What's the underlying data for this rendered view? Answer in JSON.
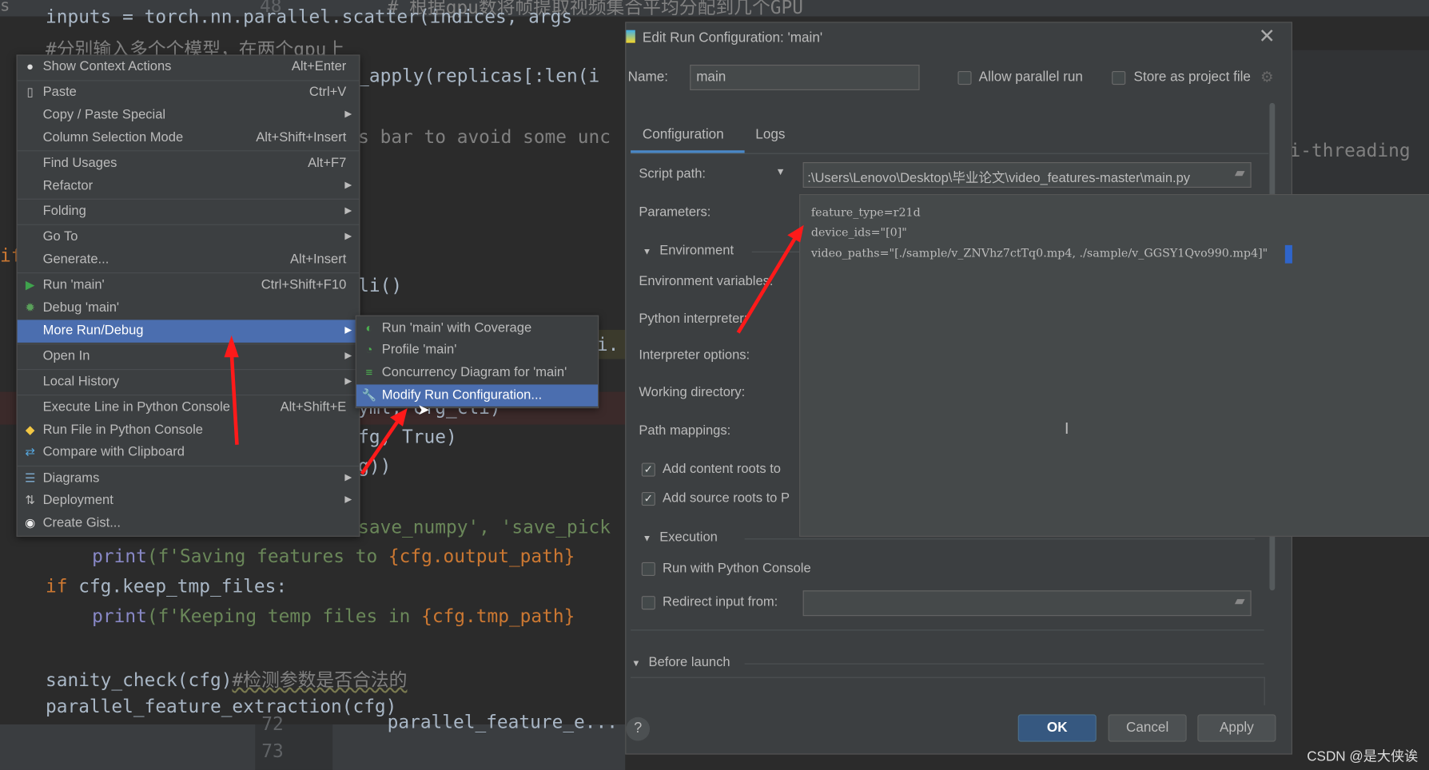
{
  "editor": {
    "top_strip": {
      "left_text": "s",
      "gutter": "48",
      "comment": "#  根据gpu数将帧提取视频集合平均分配到几个GPU"
    },
    "lines": [
      {
        "text": "inputs = torch.nn.parallel.scatter(indices, args"
      },
      {
        "text": "#分别输入多个个模型，在两个gpu上"
      },
      {
        "text": "_apply(replicas[:len(i"
      },
      {
        "text": "s bar to avoid some unc"
      },
      {
        "text": "i-threading"
      },
      {
        "text": "if"
      },
      {
        "text": "li()"
      },
      {
        "text": "i."
      },
      {
        "text": "yml, cfg_cli)"
      },
      {
        "text": "fg, True)"
      },
      {
        "text": "g))"
      },
      {
        "text": "save_numpy', 'save_pick"
      },
      {
        "kw": "print",
        "text": "(f'Saving features to ",
        "var": "{cfg.output_path}"
      },
      {
        "kw": "if",
        "text": " cfg.keep_tmp_files:"
      },
      {
        "kw": "print",
        "text": "(f'Keeping temp files in ",
        "var": "{cfg.tmp_path}"
      },
      {
        "text": "sanity_check(cfg)",
        "comment": "#检测参数是否合法的"
      },
      {
        "text": "parallel_feature_extraction(cfg)"
      }
    ],
    "bottom_strip": {
      "gutter1": "72",
      "gutter2": "73",
      "code": "parallel_feature_e..."
    }
  },
  "context_menu": {
    "items": [
      {
        "label": "Show Context Actions",
        "shortcut": "Alt+Enter",
        "icon": "bulb-icon"
      },
      {
        "label": "Paste",
        "shortcut": "Ctrl+V",
        "icon": "clipboard-icon"
      },
      {
        "label": "Copy / Paste Special",
        "submenu": true
      },
      {
        "label": "Column Selection Mode",
        "shortcut": "Alt+Shift+Insert"
      },
      {
        "label": "Find Usages",
        "shortcut": "Alt+F7"
      },
      {
        "label": "Refactor",
        "submenu": true
      },
      {
        "label": "Folding",
        "submenu": true
      },
      {
        "label": "Go To",
        "submenu": true
      },
      {
        "label": "Generate...",
        "shortcut": "Alt+Insert"
      },
      {
        "label": "Run 'main'",
        "shortcut": "Ctrl+Shift+F10",
        "icon": "run-icon"
      },
      {
        "label": "Debug 'main'",
        "icon": "debug-icon"
      },
      {
        "label": "More Run/Debug",
        "submenu": true,
        "selected": true
      },
      {
        "label": "Open In",
        "submenu": true
      },
      {
        "label": "Local History",
        "submenu": true
      },
      {
        "label": "Execute Line in Python Console",
        "shortcut": "Alt+Shift+E"
      },
      {
        "label": "Run File in Python Console",
        "icon": "python-icon"
      },
      {
        "label": "Compare with Clipboard",
        "icon": "compare-icon"
      },
      {
        "label": "Diagrams",
        "submenu": true,
        "icon": "diagram-icon"
      },
      {
        "label": "Deployment",
        "submenu": true,
        "icon": "deployment-icon"
      },
      {
        "label": "Create Gist...",
        "icon": "github-icon"
      }
    ]
  },
  "submenu": {
    "items": [
      {
        "label": "Run 'main' with Coverage",
        "icon": "coverage-icon"
      },
      {
        "label": "Profile 'main'",
        "icon": "profile-icon"
      },
      {
        "label": "Concurrency Diagram for 'main'",
        "icon": "concurrency-icon"
      },
      {
        "label": "Modify Run Configuration...",
        "icon": "wrench-icon",
        "selected": true
      }
    ]
  },
  "dialog": {
    "title": "Edit Run Configuration: 'main'",
    "name_label": "Name:",
    "name_value": "main",
    "allow_parallel_run": {
      "label": "Allow parallel run",
      "checked": false
    },
    "store_as_project_file": {
      "label": "Store as project file",
      "checked": false
    },
    "tabs": [
      {
        "label": "Configuration",
        "active": true
      },
      {
        "label": "Logs",
        "active": false
      }
    ],
    "script_path_label": "Script path:",
    "script_path_value": ":\\Users\\Lenovo\\Desktop\\毕业论文\\video_features-master\\main.py",
    "parameters_label": "Parameters:",
    "parameters_lines": [
      "feature_type=r21d",
      "device_ids=\"[0]\"",
      "video_paths=\"[./sample/v_ZNVhz7ctTq0.mp4, ./sample/v_GGSY1Qvo990.mp4]\""
    ],
    "environment_section": "Environment",
    "env_vars_label": "Environment variables:",
    "python_interpreter_label": "Python interpreter:",
    "interpreter_options_label": "Interpreter options:",
    "working_directory_label": "Working directory:",
    "path_mappings_label": "Path mappings:",
    "add_content_roots": {
      "label": "Add content roots to",
      "checked": true
    },
    "add_source_roots": {
      "label": "Add source roots to P",
      "checked": true
    },
    "execution_section": "Execution",
    "run_with_console": {
      "label": "Run with Python Console",
      "checked": false
    },
    "redirect_input": {
      "label": "Redirect input from:",
      "checked": false,
      "value": ""
    },
    "before_launch_section": "Before launch",
    "help": "?",
    "ok": "OK",
    "cancel": "Cancel",
    "apply": "Apply"
  },
  "watermark": "CSDN @是大侠诶",
  "colors": {
    "accent": "#4b6eaf",
    "ok_button": "#365880",
    "annotation_arrow": "#ff1a1a"
  }
}
